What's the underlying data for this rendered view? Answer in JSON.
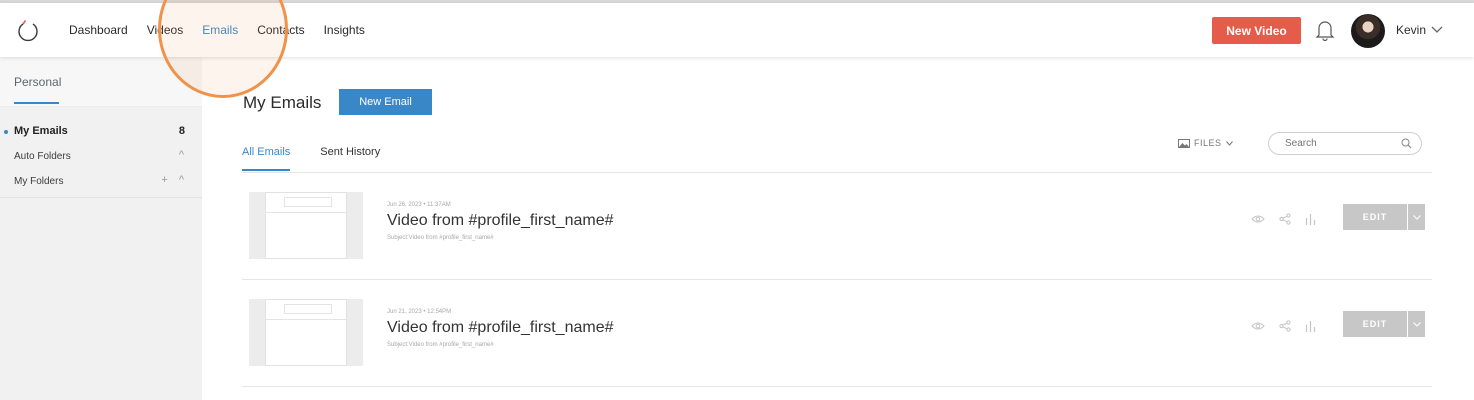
{
  "topbar": {
    "nav": [
      "Dashboard",
      "Videos",
      "Emails",
      "Contacts",
      "Insights"
    ],
    "active_nav": "Emails",
    "new_video_label": "New Video",
    "user_name": "Kevin"
  },
  "sidebar": {
    "tab": "Personal",
    "items": [
      {
        "label": "My Emails",
        "count": "8"
      },
      {
        "label": "Auto Folders",
        "controls": "^"
      },
      {
        "label": "My Folders",
        "controls": "+ ^"
      }
    ]
  },
  "main": {
    "title": "My Emails",
    "new_email_label": "New Email",
    "tabs": [
      "All Emails",
      "Sent History"
    ],
    "files_label": "FILES",
    "search_placeholder": "Search",
    "rows": [
      {
        "date": "Jun 26, 2023  •  11:37AM",
        "title": "Video from #profile_first_name#",
        "subject": "Subject:Video from #profile_first_name#",
        "edit_label": "EDIT"
      },
      {
        "date": "Jun 21, 2023  •  12:54PM",
        "title": "Video from #profile_first_name#",
        "subject": "Subject:Video from #profile_first_name#",
        "edit_label": "EDIT"
      }
    ]
  },
  "colors": {
    "accent": "#3a87c7",
    "new_video": "#e55c4a",
    "highlight": "#f0924a",
    "edit": "#c7c7c7"
  },
  "icons": [
    "logo-icon",
    "bell-icon",
    "chevron-down-icon",
    "image-icon",
    "search-icon",
    "eye-icon",
    "share-icon",
    "bar-chart-icon"
  ]
}
